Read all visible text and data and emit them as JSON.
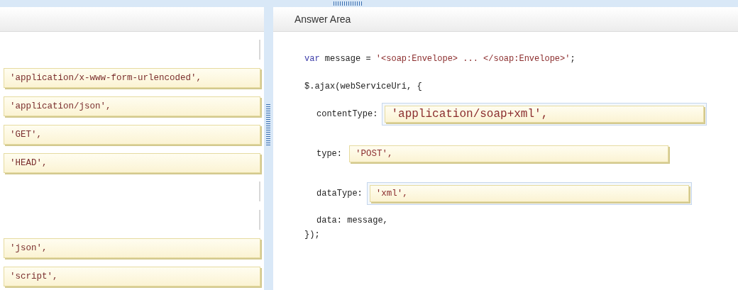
{
  "choices": [
    {
      "kind": "empty"
    },
    {
      "kind": "option",
      "text": "'application/x-www-form-urlencoded',"
    },
    {
      "kind": "option",
      "text": "'application/json',"
    },
    {
      "kind": "option",
      "text": "'GET',"
    },
    {
      "kind": "option",
      "text": "'HEAD',"
    },
    {
      "kind": "empty"
    },
    {
      "kind": "empty"
    },
    {
      "kind": "option",
      "text": "'json',"
    },
    {
      "kind": "option",
      "text": "'script',"
    }
  ],
  "answer_area": {
    "title": "Answer Area",
    "lines": [
      {
        "kind": "code",
        "segments": [
          {
            "kind": "keyword",
            "text": "var"
          },
          {
            "kind": "plain",
            "text": " message = "
          },
          {
            "kind": "string",
            "text": "'<soap:Envelope> ... </soap:Envelope>'"
          },
          {
            "kind": "plain",
            "text": ";"
          }
        ]
      },
      {
        "kind": "code",
        "segments": [
          {
            "kind": "plain",
            "text": "$.ajax(webServiceUri, {"
          }
        ]
      },
      {
        "kind": "slot",
        "label": "contentType:",
        "value": "'application/soap+xml',",
        "large": true,
        "highlighted": true
      },
      {
        "kind": "slot",
        "label": "type:",
        "value": "'POST',",
        "large": false,
        "highlighted": false
      },
      {
        "kind": "slot",
        "label": "dataType:",
        "value": "'xml',",
        "large": false,
        "highlighted": true
      },
      {
        "kind": "code",
        "indent": true,
        "segments": [
          {
            "kind": "plain",
            "text": "data: message,"
          }
        ]
      },
      {
        "kind": "code",
        "segments": [
          {
            "kind": "plain",
            "text": "});"
          }
        ]
      }
    ]
  }
}
